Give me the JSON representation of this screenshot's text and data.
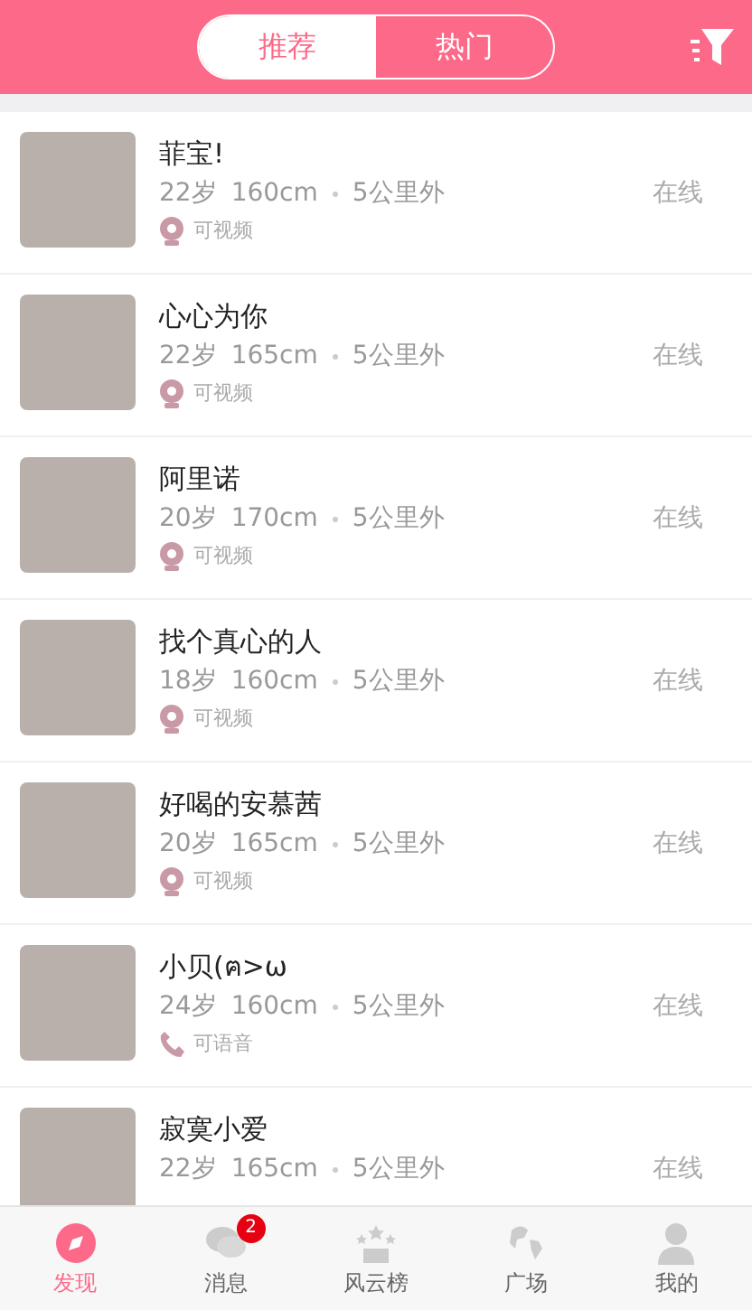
{
  "tabs": [
    {
      "label": "推荐",
      "selected": true
    },
    {
      "label": "热门",
      "selected": false
    }
  ],
  "users": [
    {
      "name": "菲宝!",
      "age": "22岁",
      "height": "160cm",
      "distance": "5公里外",
      "status": "在线",
      "capability": {
        "kind": "video",
        "label": "可视频"
      }
    },
    {
      "name": "心心为你",
      "age": "22岁",
      "height": "165cm",
      "distance": "5公里外",
      "status": "在线",
      "capability": {
        "kind": "video",
        "label": "可视频"
      }
    },
    {
      "name": "阿里诺",
      "age": "20岁",
      "height": "170cm",
      "distance": "5公里外",
      "status": "在线",
      "capability": {
        "kind": "video",
        "label": "可视频"
      }
    },
    {
      "name": "找个真心的人",
      "age": "18岁",
      "height": "160cm",
      "distance": "5公里外",
      "status": "在线",
      "capability": {
        "kind": "video",
        "label": "可视频"
      }
    },
    {
      "name": "好喝的安慕茜",
      "age": "20岁",
      "height": "165cm",
      "distance": "5公里外",
      "status": "在线",
      "capability": {
        "kind": "video",
        "label": "可视频"
      }
    },
    {
      "name": "小贝(ฅ>ω",
      "age": "24岁",
      "height": "160cm",
      "distance": "5公里外",
      "status": "在线",
      "capability": {
        "kind": "voice",
        "label": "可语音"
      }
    },
    {
      "name": "寂寞小爱",
      "age": "22岁",
      "height": "165cm",
      "distance": "5公里外",
      "status": "在线"
    }
  ],
  "nav": [
    {
      "kind": "compass",
      "label": "发现",
      "selected": true
    },
    {
      "kind": "chat",
      "label": "消息",
      "selected": false,
      "badge": "2"
    },
    {
      "kind": "podium",
      "label": "风云榜",
      "selected": false
    },
    {
      "kind": "globe",
      "label": "广场",
      "selected": false
    },
    {
      "kind": "person",
      "label": "我的",
      "selected": false
    }
  ]
}
